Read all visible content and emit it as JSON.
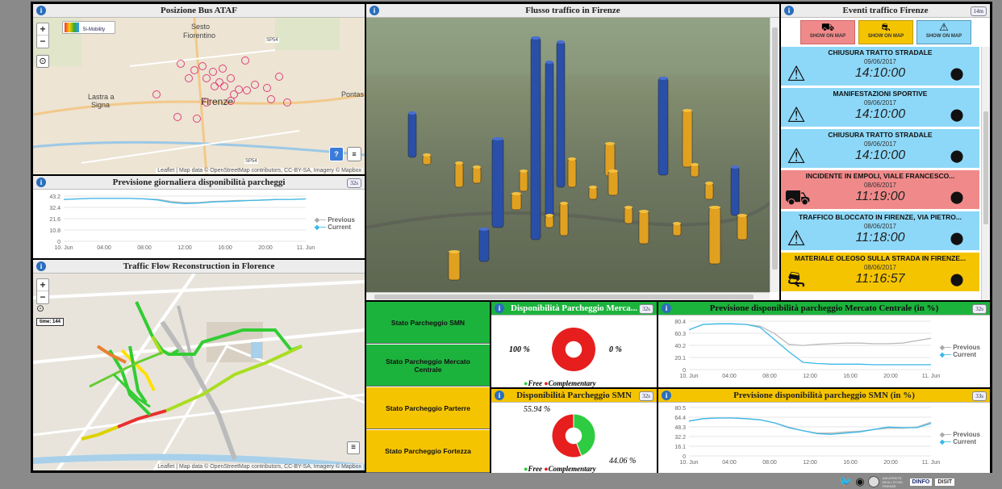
{
  "ataf": {
    "title": "Posizione Bus ATAF",
    "places": [
      "Sesto",
      "Fiorentino",
      "Lastra a",
      "Signa",
      "Firenze",
      "Pontas",
      "SP54",
      "SP54"
    ],
    "si_mobility": "Si-Mobility",
    "attribution": "Leaflet | Map data © OpenStreetMap contributors, CC-BY-SA, Imagery © Mapbox"
  },
  "parking_forecast": {
    "title": "Previsione giornaliera disponibilità parcheggi",
    "badge": "32s",
    "legend": [
      "Previous",
      "Current"
    ]
  },
  "traffic_recon": {
    "title": "Traffic Flow Reconstruction in Florence",
    "time_label": "time: 144",
    "attribution": "Leaflet | Map data © OpenStreetMap contributors, CC-BY-SA, Imagery © Mapbox"
  },
  "flusso": {
    "title": "Flusso traffico in Firenze"
  },
  "events": {
    "title": "Eventi traffico Firenze",
    "badge": "14m",
    "buttons": [
      "SHOW ON MAP",
      "SHOW ON MAP",
      "SHOW ON MAP"
    ],
    "items": [
      {
        "title": "CHIUSURA TRATTO STRADALE",
        "date": "09/06/2017",
        "time": "14:10:00",
        "icon": "warning-icon",
        "color": "#8dd8f8"
      },
      {
        "title": "MANIFESTAZIONI SPORTIVE",
        "date": "09/06/2017",
        "time": "14:10:00",
        "icon": "warning-icon",
        "color": "#8dd8f8"
      },
      {
        "title": "CHIUSURA TRATTO STRADALE",
        "date": "09/06/2017",
        "time": "14:10:00",
        "icon": "warning-icon",
        "color": "#8dd8f8"
      },
      {
        "title": "INCIDENTE IN EMPOLI, VIALE FRANCESCO...",
        "date": "08/06/2017",
        "time": "11:19:00",
        "icon": "car-crash-icon",
        "color": "#f08a8a"
      },
      {
        "title": "TRAFFICO BLOCCATO IN FIRENZE, VIA PIETRO...",
        "date": "08/06/2017",
        "time": "11:18:00",
        "icon": "warning-icon",
        "color": "#8dd8f8"
      },
      {
        "title": "MATERIALE OLEOSO SULLA STRADA IN FIRENZE...",
        "date": "08/06/2017",
        "time": "11:16:57",
        "icon": "slippery-road-icon",
        "color": "#f5c400"
      }
    ]
  },
  "parking_status": [
    {
      "label": "Stato Parcheggio SMN",
      "color": "#1cb33c"
    },
    {
      "label": "Stato Parcheggio Mercato Centrale",
      "color": "#1cb33c"
    },
    {
      "label": "Stato Parcheggio Parterre",
      "color": "#f5c400"
    },
    {
      "label": "Stato Parcheggio Fortezza",
      "color": "#f5c400"
    }
  ],
  "disp_mercato": {
    "title": "Disponibilità Parcheggio Merca...",
    "badge": "32s",
    "left": "100 %",
    "right": "0 %",
    "legend": [
      "Free",
      "Complementary"
    ]
  },
  "disp_smn": {
    "title": "Disponibilità Parcheggio SMN",
    "badge": "32s",
    "top": "55.94 %",
    "bottom": "44.06 %",
    "legend": [
      "Free",
      "Complementary"
    ]
  },
  "prev_mercato": {
    "title": "Previsione disponibilità parcheggio Mercato Centrale (in %)",
    "badge": "32s",
    "legend": [
      "Previous",
      "Current"
    ]
  },
  "prev_smn": {
    "title": "Previsione disponibilità parcheggio SMN (in %)",
    "badge": "33s",
    "legend": [
      "Previous",
      "Current"
    ]
  },
  "footer": {
    "dinfo": "DINFO",
    "disit": "DISIT",
    "univ": "UNIVERSITÀ DEGLI STUDI FIRENZE"
  },
  "chart_data": [
    {
      "type": "line",
      "title": "Previsione giornaliera disponibilità parcheggi",
      "x_ticks": [
        "10. Jun",
        "04:00",
        "08:00",
        "12:00",
        "16:00",
        "20:00",
        "11. Jun"
      ],
      "y_ticks": [
        "0",
        "10.8",
        "21.6",
        "32.4",
        "43.2"
      ],
      "ylim": [
        0,
        43.2
      ],
      "series": [
        {
          "name": "Previous",
          "color": "#bbbbbb",
          "values": [
            40,
            40.5,
            41,
            41,
            41,
            41,
            40.5,
            40,
            38,
            37,
            37,
            38,
            38.5,
            39,
            39,
            39.5,
            40,
            40,
            40.5
          ]
        },
        {
          "name": "Current",
          "color": "#3bb8e8",
          "values": [
            40,
            40.5,
            41,
            41,
            41,
            41,
            40.5,
            39.5,
            37,
            36,
            36.5,
            37.5,
            38,
            38.5,
            39,
            39.5,
            40,
            40,
            40.5
          ]
        }
      ]
    },
    {
      "type": "line",
      "title": "Previsione disponibilità parcheggio Mercato Centrale (in %)",
      "x_ticks": [
        "10. Jun",
        "04:00",
        "08:00",
        "12:00",
        "16:00",
        "20:00",
        "11. Jun"
      ],
      "y_ticks": [
        "0",
        "20.1",
        "40.2",
        "60.3",
        "80.4"
      ],
      "ylim": [
        0,
        80.4
      ],
      "series": [
        {
          "name": "Previous",
          "color": "#bbbbbb",
          "values": [
            66,
            75,
            76,
            76,
            75,
            72,
            60,
            42,
            40,
            42,
            43,
            44,
            44,
            43,
            43,
            44,
            48,
            52
          ]
        },
        {
          "name": "Current",
          "color": "#3bb8e8",
          "values": [
            66,
            75,
            76,
            76,
            75,
            70,
            50,
            30,
            12,
            10,
            9,
            9,
            9,
            8,
            8,
            8,
            8,
            8
          ]
        }
      ]
    },
    {
      "type": "line",
      "title": "Previsione disponibilità parcheggio SMN (in %)",
      "x_ticks": [
        "10. Jun",
        "04:00",
        "08:00",
        "12:00",
        "16:00",
        "20:00",
        "11. Jun"
      ],
      "y_ticks": [
        "0",
        "16.1",
        "32.2",
        "48.3",
        "64.4",
        "80.5"
      ],
      "ylim": [
        0,
        80.5
      ],
      "series": [
        {
          "name": "Previous",
          "color": "#bbbbbb",
          "values": [
            58,
            62,
            63,
            63,
            62,
            60,
            55,
            48,
            42,
            38,
            38,
            40,
            41,
            44,
            46,
            46,
            48,
            56
          ]
        },
        {
          "name": "Current",
          "color": "#3bb8e8",
          "values": [
            58,
            62,
            63,
            63,
            62,
            60,
            55,
            47,
            42,
            37,
            36,
            38,
            40,
            44,
            48,
            47,
            47,
            54
          ]
        }
      ]
    },
    {
      "type": "pie",
      "title": "Disponibilità Parcheggio Merca...",
      "labels": [
        "Free",
        "Complementary"
      ],
      "values": [
        100,
        0
      ],
      "colors": [
        "#2ecc40",
        "#e61e1e"
      ]
    },
    {
      "type": "pie",
      "title": "Disponibilità Parcheggio SMN",
      "labels": [
        "Free",
        "Complementary"
      ],
      "values": [
        44.06,
        55.94
      ],
      "colors": [
        "#2ecc40",
        "#e61e1e"
      ]
    }
  ]
}
